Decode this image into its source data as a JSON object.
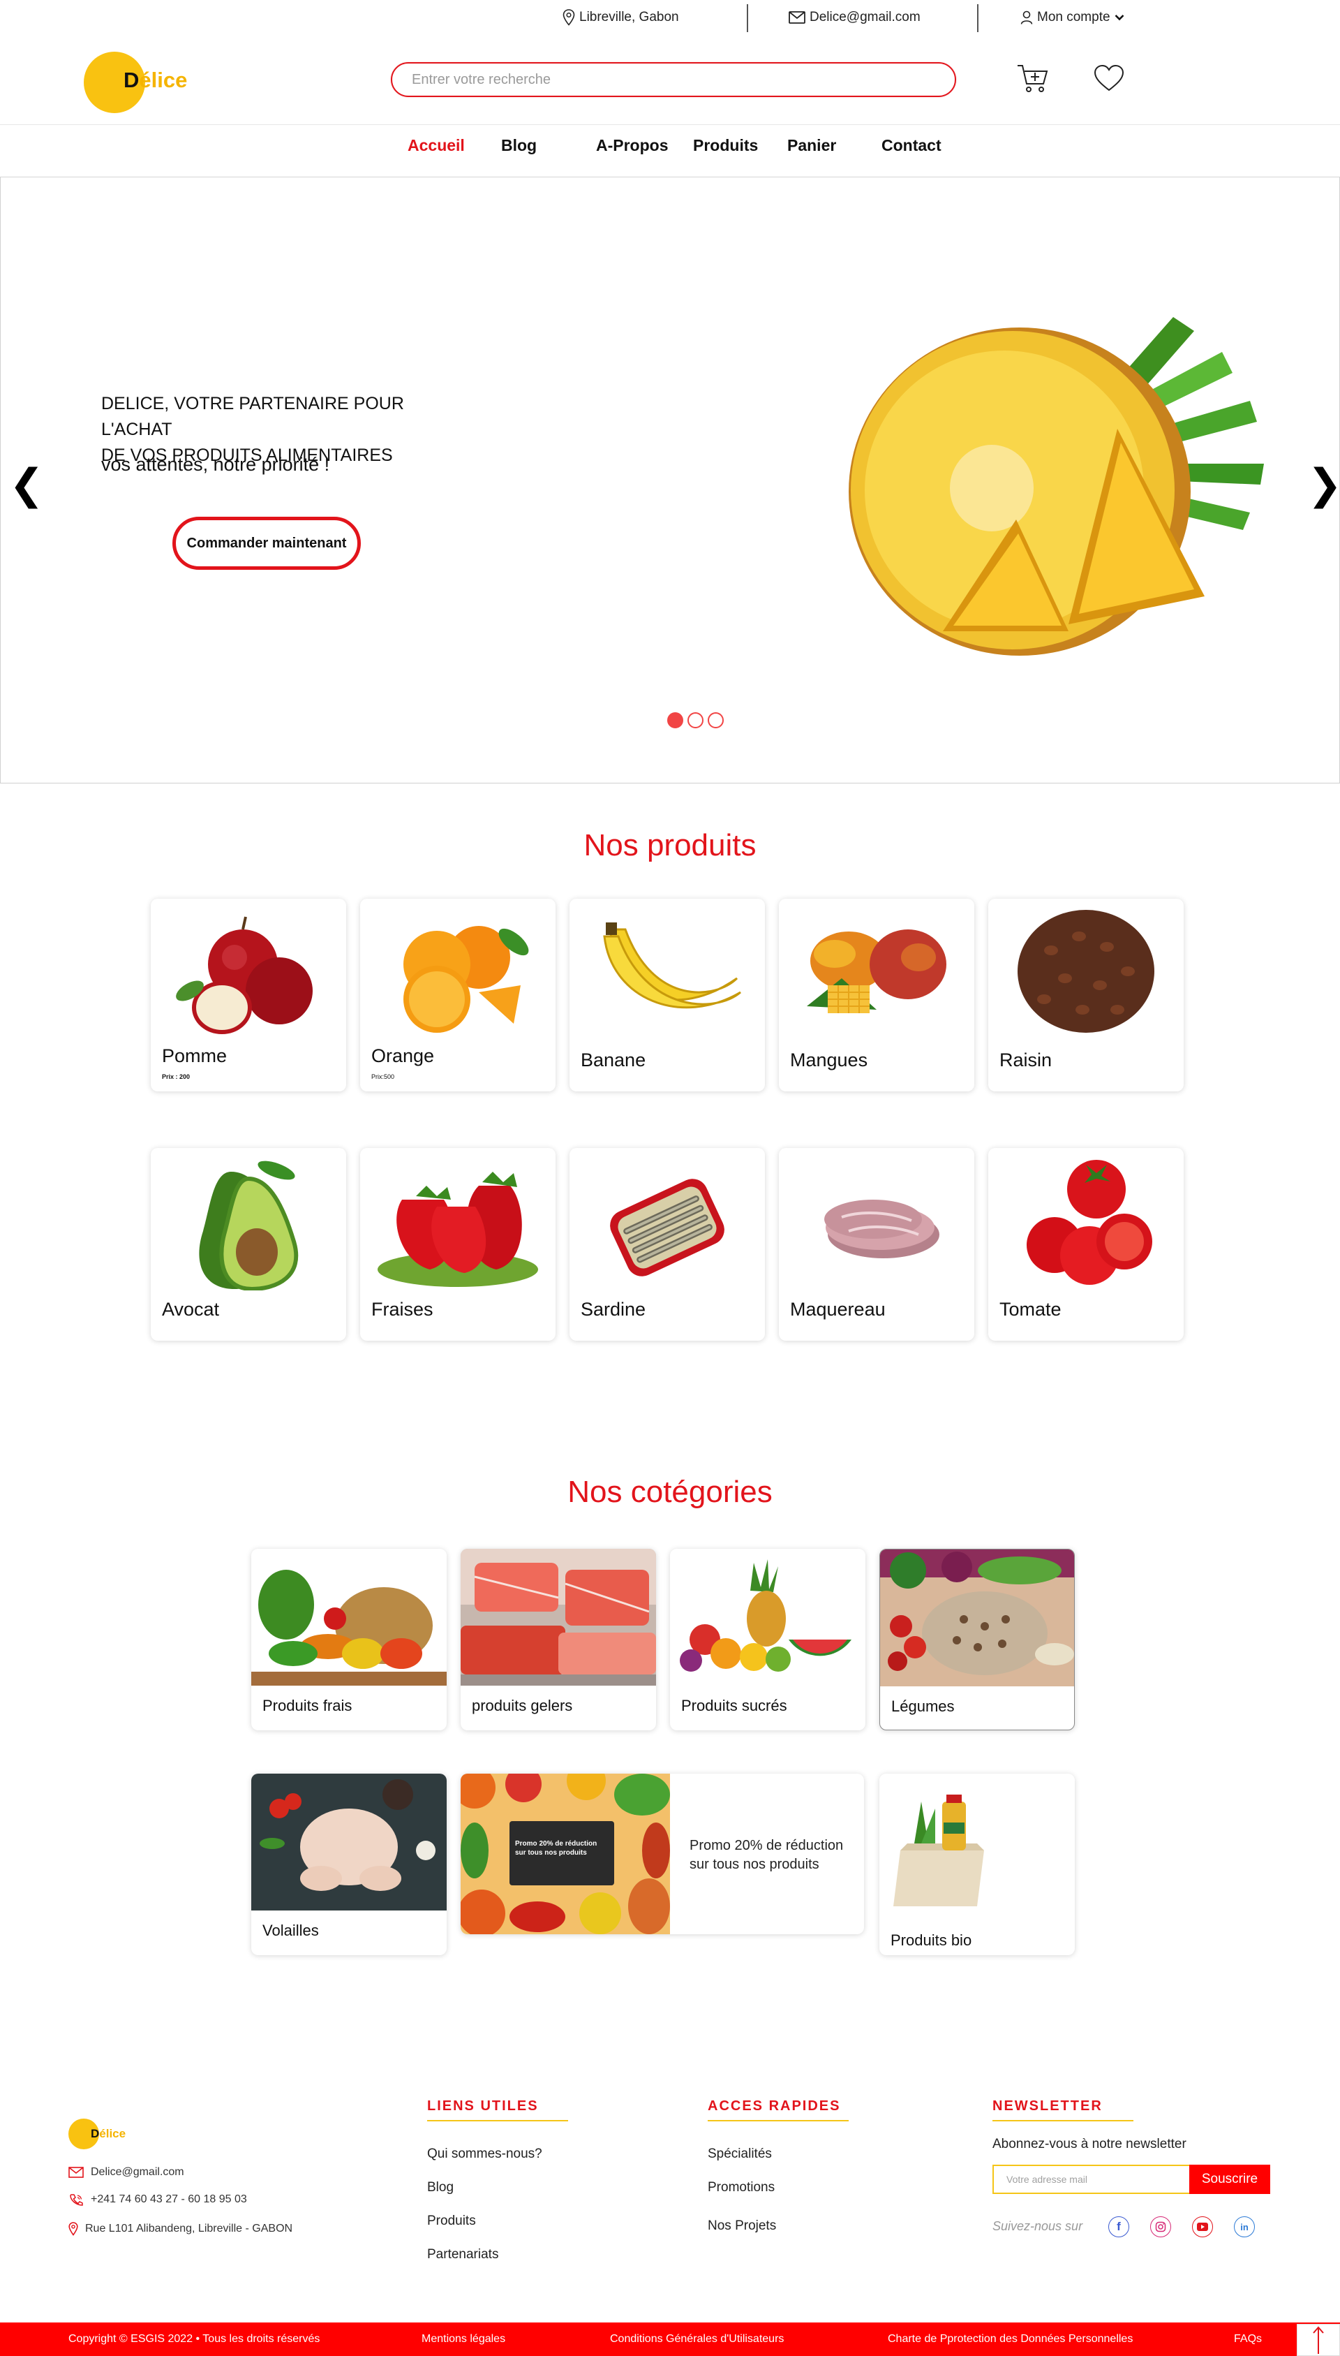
{
  "topbar": {
    "location": "Libreville, Gabon",
    "email": "Delice@gmail.com",
    "account": "Mon compte"
  },
  "header": {
    "logo_d": "D",
    "logo_rest": "élice",
    "search_placeholder": "Entrer votre recherche"
  },
  "nav": {
    "items": [
      "Accueil",
      "Blog",
      "A-Propos",
      "Produits",
      "Panier",
      "Contact"
    ],
    "active": "Accueil"
  },
  "hero": {
    "title_line1": "DELICE, VOTRE PARTENAIRE POUR L'ACHAT",
    "title_line2": "DE VOS PRODUITS ALIMENTAIRES",
    "subtitle": "vos attentes, notre priorité !",
    "cta": "Commander maintenant",
    "prev": "❮",
    "next": "❯",
    "slide_count": 3,
    "active_slide": 1
  },
  "products": {
    "title": "Nos produits",
    "items": [
      {
        "name": "Pomme",
        "price": "Prix : 200"
      },
      {
        "name": "Orange",
        "price": "Prix:500"
      },
      {
        "name": "Banane",
        "price": ""
      },
      {
        "name": "Mangues",
        "price": ""
      },
      {
        "name": "Raisin",
        "price": ""
      },
      {
        "name": "Avocat",
        "price": ""
      },
      {
        "name": "Fraises",
        "price": ""
      },
      {
        "name": "Sardine",
        "price": ""
      },
      {
        "name": "Maquereau",
        "price": ""
      },
      {
        "name": "Tomate",
        "price": ""
      }
    ]
  },
  "categories": {
    "title": "Nos cotégories",
    "items": [
      "Produits frais",
      "produits gelers",
      "Produits sucrés",
      "Légumes",
      "Volailles",
      "Produits bio"
    ],
    "promo_image_text_line1": "Promo 20% de réduction",
    "promo_image_text_line2": "sur tous nos produits",
    "promo_line1": "Promo 20% de réduction",
    "promo_line2": "sur tous nos produits"
  },
  "footer": {
    "logo_d": "D",
    "logo_rest": "élice",
    "email": "Delice@gmail.com",
    "phone": "+241 74 60 43 27 - 60 18 95 03",
    "address": "Rue L101 Alibandeng, Libreville - GABON",
    "useful_links_title": "LIENS UTILES",
    "useful_links": [
      "Qui sommes-nous?",
      "Blog",
      "Produits",
      "Partenariats"
    ],
    "quick_access_title": "ACCES RAPIDES",
    "quick_access": [
      "Spécialités",
      "Promotions",
      "Nos Projets"
    ],
    "newsletter_title": "NEWSLETTER",
    "newsletter_text": "Abonnez-vous à notre newsletter",
    "newsletter_placeholder": "Votre adresse mail",
    "newsletter_button": "Souscrire",
    "follow_text": "Suivez-nous sur"
  },
  "bottom_bar": {
    "copyright": "Copyright © ESGIS 2022 • Tous les droits réservés",
    "legal": "Mentions légales",
    "terms": "Conditions Générales d'Utilisateurs",
    "privacy": "Charte de Pprotection des Données Personnelles",
    "faq": "FAQs"
  },
  "colors": {
    "accent_red": "#e2141b",
    "logo_yellow": "#f9c211",
    "bottom_bar": "#ff0000"
  }
}
